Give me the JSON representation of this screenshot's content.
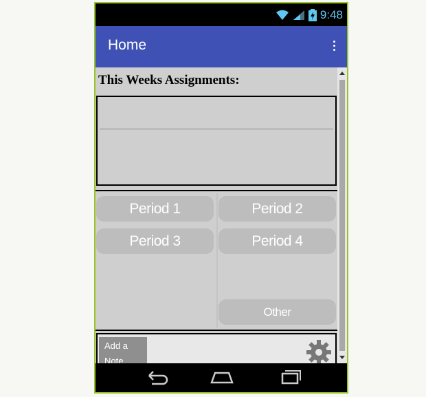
{
  "statusbar": {
    "time": "9:48",
    "wifi_icon": "wifi-icon",
    "signal_icon": "signal-icon",
    "battery_icon": "battery-charging-icon"
  },
  "appbar": {
    "title": "Home",
    "menu_icon": "overflow-menu-icon",
    "color": "#3f51b5"
  },
  "main": {
    "heading": "This Weeks Assignments:",
    "periods": [
      "Period 1",
      "Period 2",
      "Period 3",
      "Period 4"
    ],
    "other_label": "Other",
    "add_note_label": "Add a Note",
    "settings_icon": "gear-icon"
  },
  "navbar": {
    "back_icon": "back-icon",
    "home_icon": "home-icon",
    "recents_icon": "recents-icon"
  },
  "colors": {
    "frame": "#9ac42c",
    "status_text": "#5fc8f2",
    "content_bg": "#cfcfcf",
    "button_bg": "#bdbdbd"
  }
}
